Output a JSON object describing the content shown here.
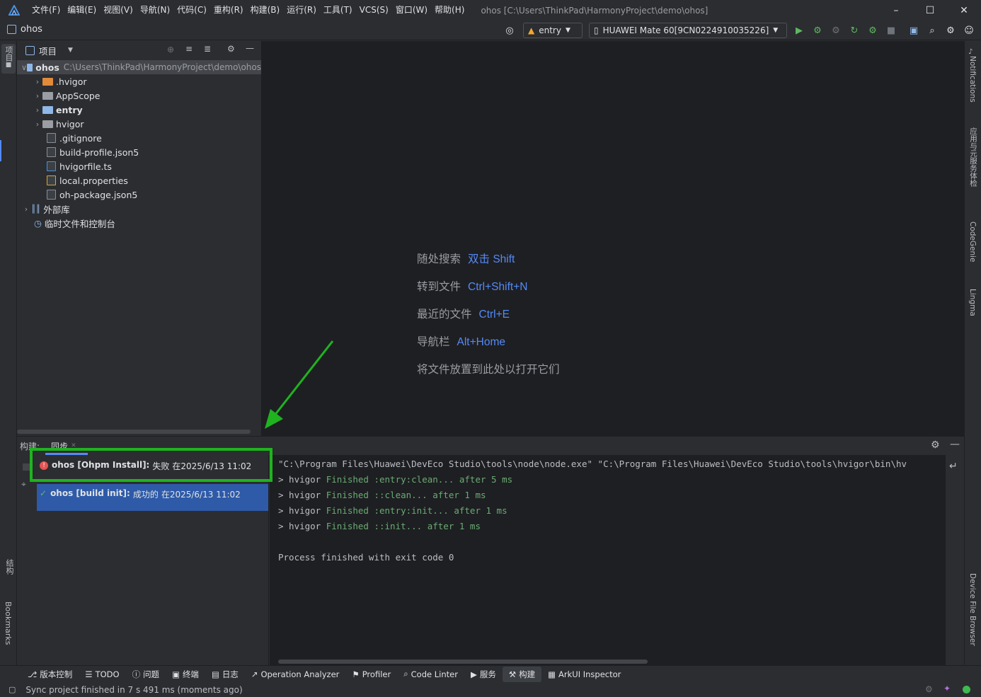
{
  "menubar": {
    "items": [
      "文件(F)",
      "编辑(E)",
      "视图(V)",
      "导航(N)",
      "代码(C)",
      "重构(R)",
      "构建(B)",
      "运行(R)",
      "工具(T)",
      "VCS(S)",
      "窗口(W)",
      "帮助(H)"
    ],
    "window_title": "ohos [C:\\Users\\ThinkPad\\HarmonyProject\\demo\\ohos]"
  },
  "toolbar": {
    "project_name": "ohos",
    "run_config": "entry",
    "device": "HUAWEI Mate 60[9CN0224910035226]"
  },
  "left_stripe": {
    "project_label": "项目",
    "structure_label": "结构",
    "bookmarks_label": "Bookmarks"
  },
  "right_stripe": {
    "notifications": "Notifications",
    "app_services": "应用与元服务体检",
    "codegenie": "CodeGenie",
    "lingma": "Lingma",
    "device_file_browser": "Device File Browser"
  },
  "project_panel": {
    "title": "项目",
    "root_name": "ohos",
    "root_path": "C:\\Users\\ThinkPad\\HarmonyProject\\demo\\ohos",
    "items": [
      {
        "label": ".hvigor"
      },
      {
        "label": "AppScope"
      },
      {
        "label": "entry"
      },
      {
        "label": "hvigor"
      },
      {
        "label": ".gitignore"
      },
      {
        "label": "build-profile.json5"
      },
      {
        "label": "hvigorfile.ts"
      },
      {
        "label": "local.properties"
      },
      {
        "label": "oh-package.json5"
      }
    ],
    "external_libs": "外部库",
    "scratches": "临时文件和控制台"
  },
  "editor_hints": [
    {
      "text": "随处搜索",
      "key": "双击 Shift"
    },
    {
      "text": "转到文件",
      "key": "Ctrl+Shift+N"
    },
    {
      "text": "最近的文件",
      "key": "Ctrl+E"
    },
    {
      "text": "导航栏",
      "key": "Alt+Home"
    },
    {
      "text": "将文件放置到此处以打开它们",
      "key": ""
    }
  ],
  "build_panel": {
    "label": "构建:",
    "tab": "同步",
    "entries": [
      {
        "name": "ohos [Ohpm Install]:",
        "status": "失败",
        "time": "在2025/6/13 11:02"
      },
      {
        "name": "ohos [build init]:",
        "status": "成功的",
        "time": "在2025/6/13 11:02"
      }
    ],
    "console": {
      "cmd": "\"C:\\Program Files\\Huawei\\DevEco Studio\\tools\\node\\node.exe\" \"C:\\Program Files\\Huawei\\DevEco Studio\\tools\\hvigor\\bin\\hv",
      "lines": [
        {
          "prefix": "> hvigor ",
          "rest": "Finished :entry:clean... after 5 ms"
        },
        {
          "prefix": "> hvigor ",
          "rest": "Finished ::clean... after 1 ms"
        },
        {
          "prefix": "> hvigor ",
          "rest": "Finished :entry:init... after 1 ms"
        },
        {
          "prefix": "> hvigor ",
          "rest": "Finished ::init... after 1 ms"
        }
      ],
      "exit": "Process finished with exit code 0"
    }
  },
  "tool_tabs": [
    "版本控制",
    "TODO",
    "问题",
    "终端",
    "日志",
    "Operation Analyzer",
    "Profiler",
    "Code Linter",
    "服务",
    "构建",
    "ArkUI Inspector"
  ],
  "status": {
    "message": "Sync project finished in 7 s 491 ms (moments ago)"
  },
  "colors": {
    "accent": "#548af7",
    "annotation": "#1fb31f",
    "error": "#e55353",
    "success": "#5fb85f"
  }
}
